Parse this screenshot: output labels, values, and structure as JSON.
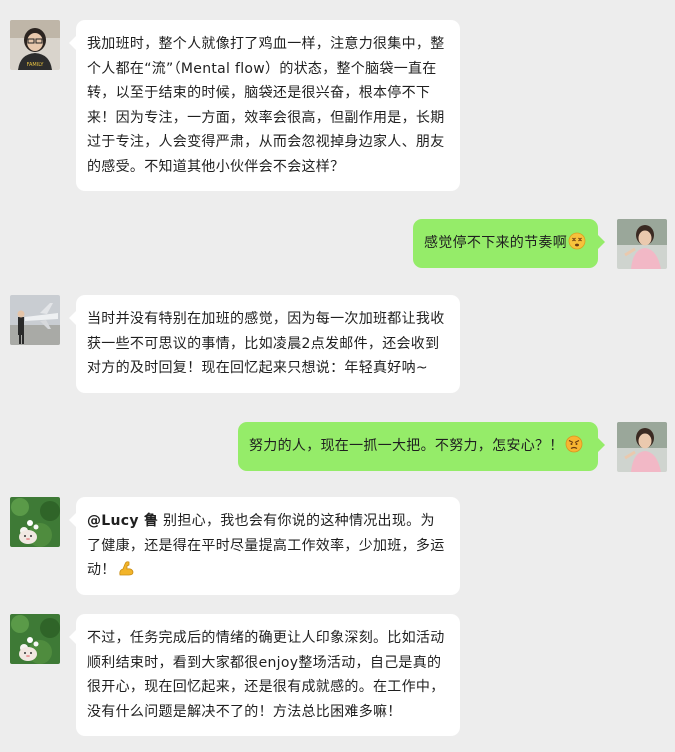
{
  "messages": [
    {
      "side": "left",
      "avatar": "avatar-girl-glasses",
      "text": "我加班时，整个人就像打了鸡血一样，注意力很集中，整个人都在“流”（Mental flow）的状态，整个脑袋一直在转，以至于结束的时候，脑袋还是很兴奋，根本停不下来！因为专注，一方面，效率会很高，但副作用是，长期过于专注，人会变得严肃，从而会忽视掉身边家人、朋友的感受。不知道其他小伙伴会不会这样？"
    },
    {
      "side": "right",
      "avatar": "avatar-woman-pink",
      "text": "感觉停不下来的节奏啊",
      "emoji": "dizzy-face-emoji"
    },
    {
      "side": "left",
      "avatar": "avatar-person-plane",
      "text": "当时并没有特别在加班的感觉，因为每一次加班都让我收获一些不可思议的事情，比如凌晨2点发邮件，还会收到对方的及时回复！现在回忆起来只想说：年轻真好呐~"
    },
    {
      "side": "right",
      "avatar": "avatar-woman-pink",
      "text": "努力的人，现在一抓一大把。不努力，怎安心？！",
      "emoji": "angry-face-emoji"
    },
    {
      "side": "left",
      "avatar": "avatar-flowers",
      "mention": "@Lucy 鲁",
      "text": " 别担心，我也会有你说的这种情况出现。为了健康，还是得在平时尽量提高工作效率，少加班，多运动！",
      "emoji": "flexed-biceps-emoji"
    },
    {
      "side": "left",
      "avatar": "avatar-flowers",
      "text": "不过，任务完成后的情绪的确更让人印象深刻。比如活动顺利结束时，看到大家都很enjoy整场活动，自己是真的很开心，现在回忆起来，还是很有成就感的。在工作中，没有什么问题是解决不了的！方法总比困难多嘛！"
    }
  ]
}
